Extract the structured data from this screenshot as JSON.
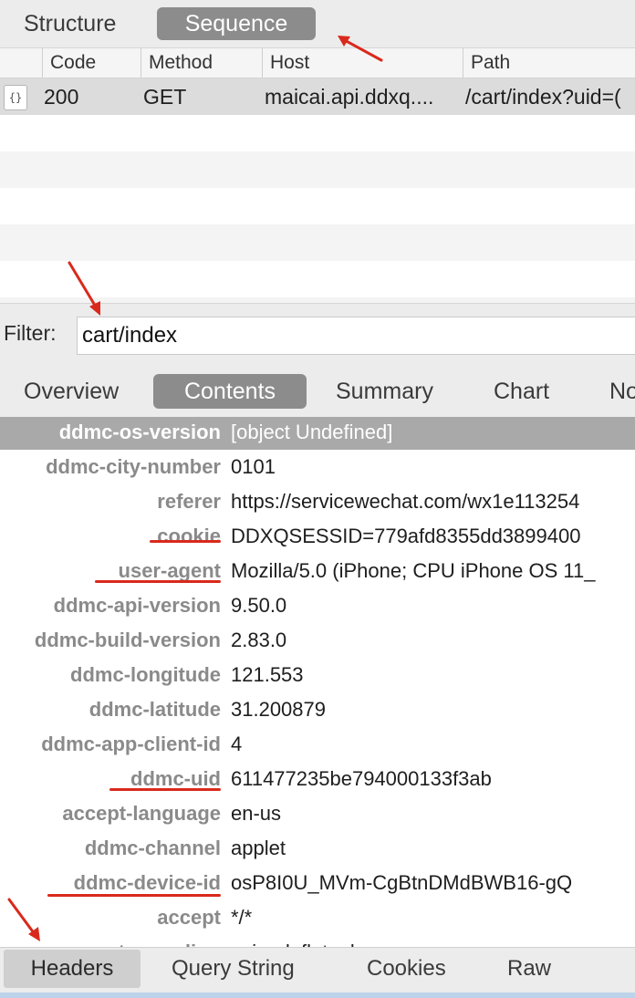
{
  "mode_tabs": {
    "structure": "Structure",
    "sequence": "Sequence"
  },
  "table": {
    "columns": {
      "code": "Code",
      "method": "Method",
      "host": "Host",
      "path": "Path"
    },
    "row": {
      "icon": "{}",
      "code": "200",
      "method": "GET",
      "host": "maicai.api.ddxq....",
      "path": "/cart/index?uid=("
    }
  },
  "filter": {
    "label": "Filter:",
    "value": "cart/index"
  },
  "detail_tabs": {
    "overview": "Overview",
    "contents": "Contents",
    "summary": "Summary",
    "chart": "Chart",
    "notes": "No"
  },
  "headers": [
    {
      "key": "ddmc-os-version",
      "value": "[object Undefined]"
    },
    {
      "key": "ddmc-city-number",
      "value": "0101"
    },
    {
      "key": "referer",
      "value": "https://servicewechat.com/wx1e113254"
    },
    {
      "key": "cookie",
      "value": "DDXQSESSID=779afd8355dd3899400"
    },
    {
      "key": "user-agent",
      "value": "Mozilla/5.0 (iPhone; CPU iPhone OS 11_"
    },
    {
      "key": "ddmc-api-version",
      "value": "9.50.0"
    },
    {
      "key": "ddmc-build-version",
      "value": "2.83.0"
    },
    {
      "key": "ddmc-longitude",
      "value": "121.553"
    },
    {
      "key": "ddmc-latitude",
      "value": "31.200879"
    },
    {
      "key": "ddmc-app-client-id",
      "value": "4"
    },
    {
      "key": "ddmc-uid",
      "value": "611477235be794000133f3ab"
    },
    {
      "key": "accept-language",
      "value": "en-us"
    },
    {
      "key": "ddmc-channel",
      "value": "applet"
    },
    {
      "key": "ddmc-device-id",
      "value": "osP8I0U_MVm-CgBtnDMdBWB16-gQ"
    },
    {
      "key": "accept",
      "value": "*/*"
    },
    {
      "key": "accept-encoding",
      "value": "gzip, deflate, br"
    }
  ],
  "bottom_tabs": {
    "headers": "Headers",
    "query_string": "Query String",
    "cookies": "Cookies",
    "raw": "Raw"
  },
  "colors": {
    "annotation_red": "#d9291c",
    "active_tab": "#8c8c8c",
    "selected_row": "#dcdcdc"
  }
}
